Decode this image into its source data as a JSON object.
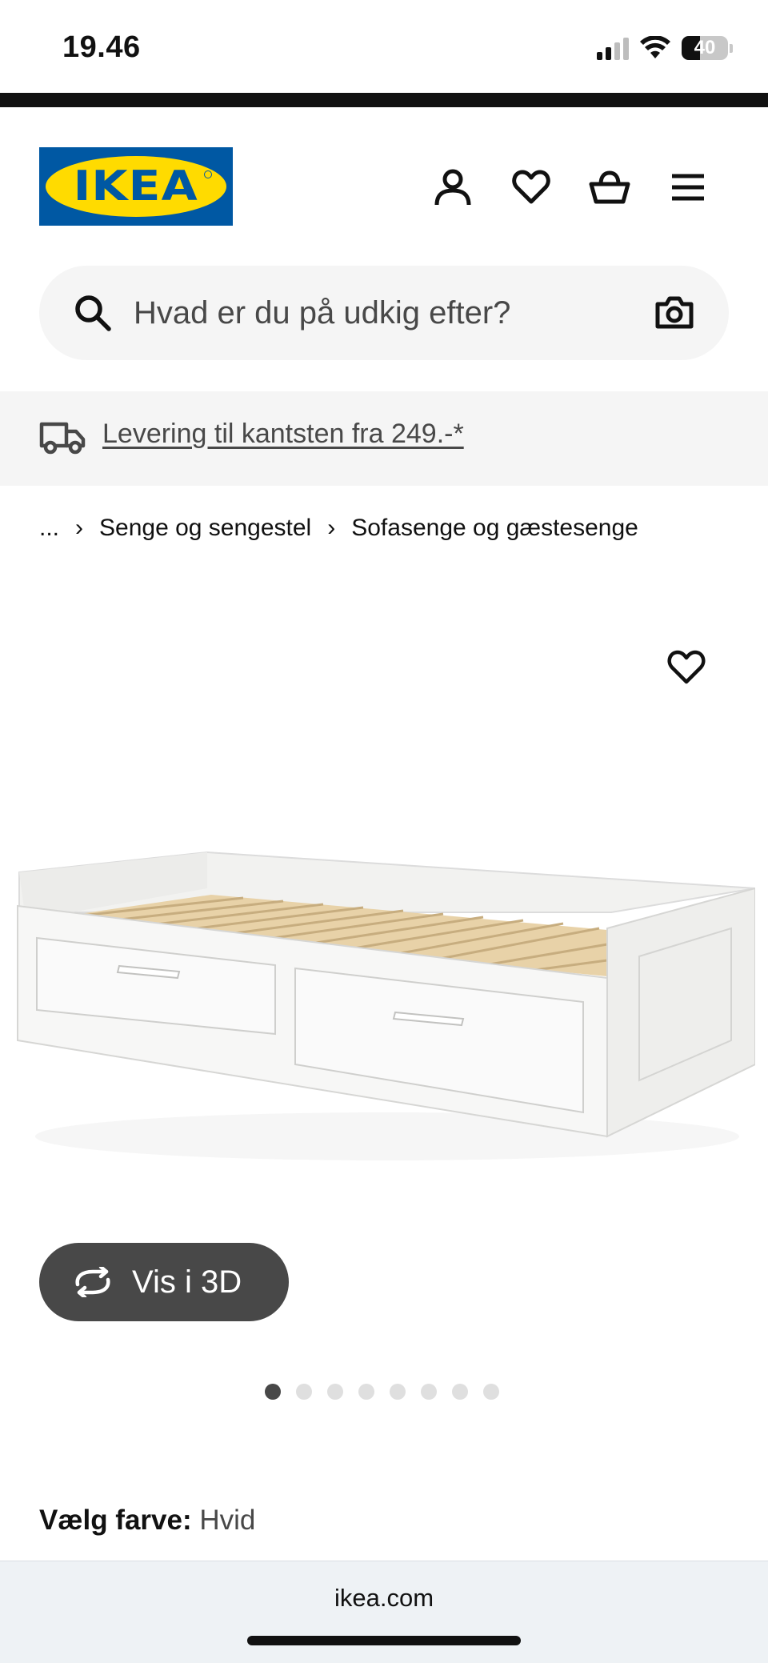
{
  "status_bar": {
    "time": "19.46",
    "battery": "40",
    "battery_level": 0.4,
    "signal_bars": 2,
    "signal_max": 4
  },
  "header": {
    "logo_text": "IKEA",
    "icons": [
      "user-icon",
      "heart-icon",
      "basket-icon",
      "menu-icon"
    ]
  },
  "search": {
    "placeholder": "Hvad er du på udkig efter?"
  },
  "promo": {
    "text": "Levering til kantsten fra 249.-*"
  },
  "breadcrumb": {
    "items": [
      "...",
      "Senge og sengestel",
      "Sofasenge og gæstesenge"
    ]
  },
  "product": {
    "view_3d_label": "Vis i 3D",
    "image_count": 8,
    "active_image": 1,
    "color_label": "Vælg farve:",
    "color_value": "Hvid"
  },
  "browser": {
    "url": "ikea.com"
  },
  "colors": {
    "ikea_blue": "#0058a3",
    "ikea_yellow": "#ffdb00",
    "button_dark": "#484848"
  }
}
